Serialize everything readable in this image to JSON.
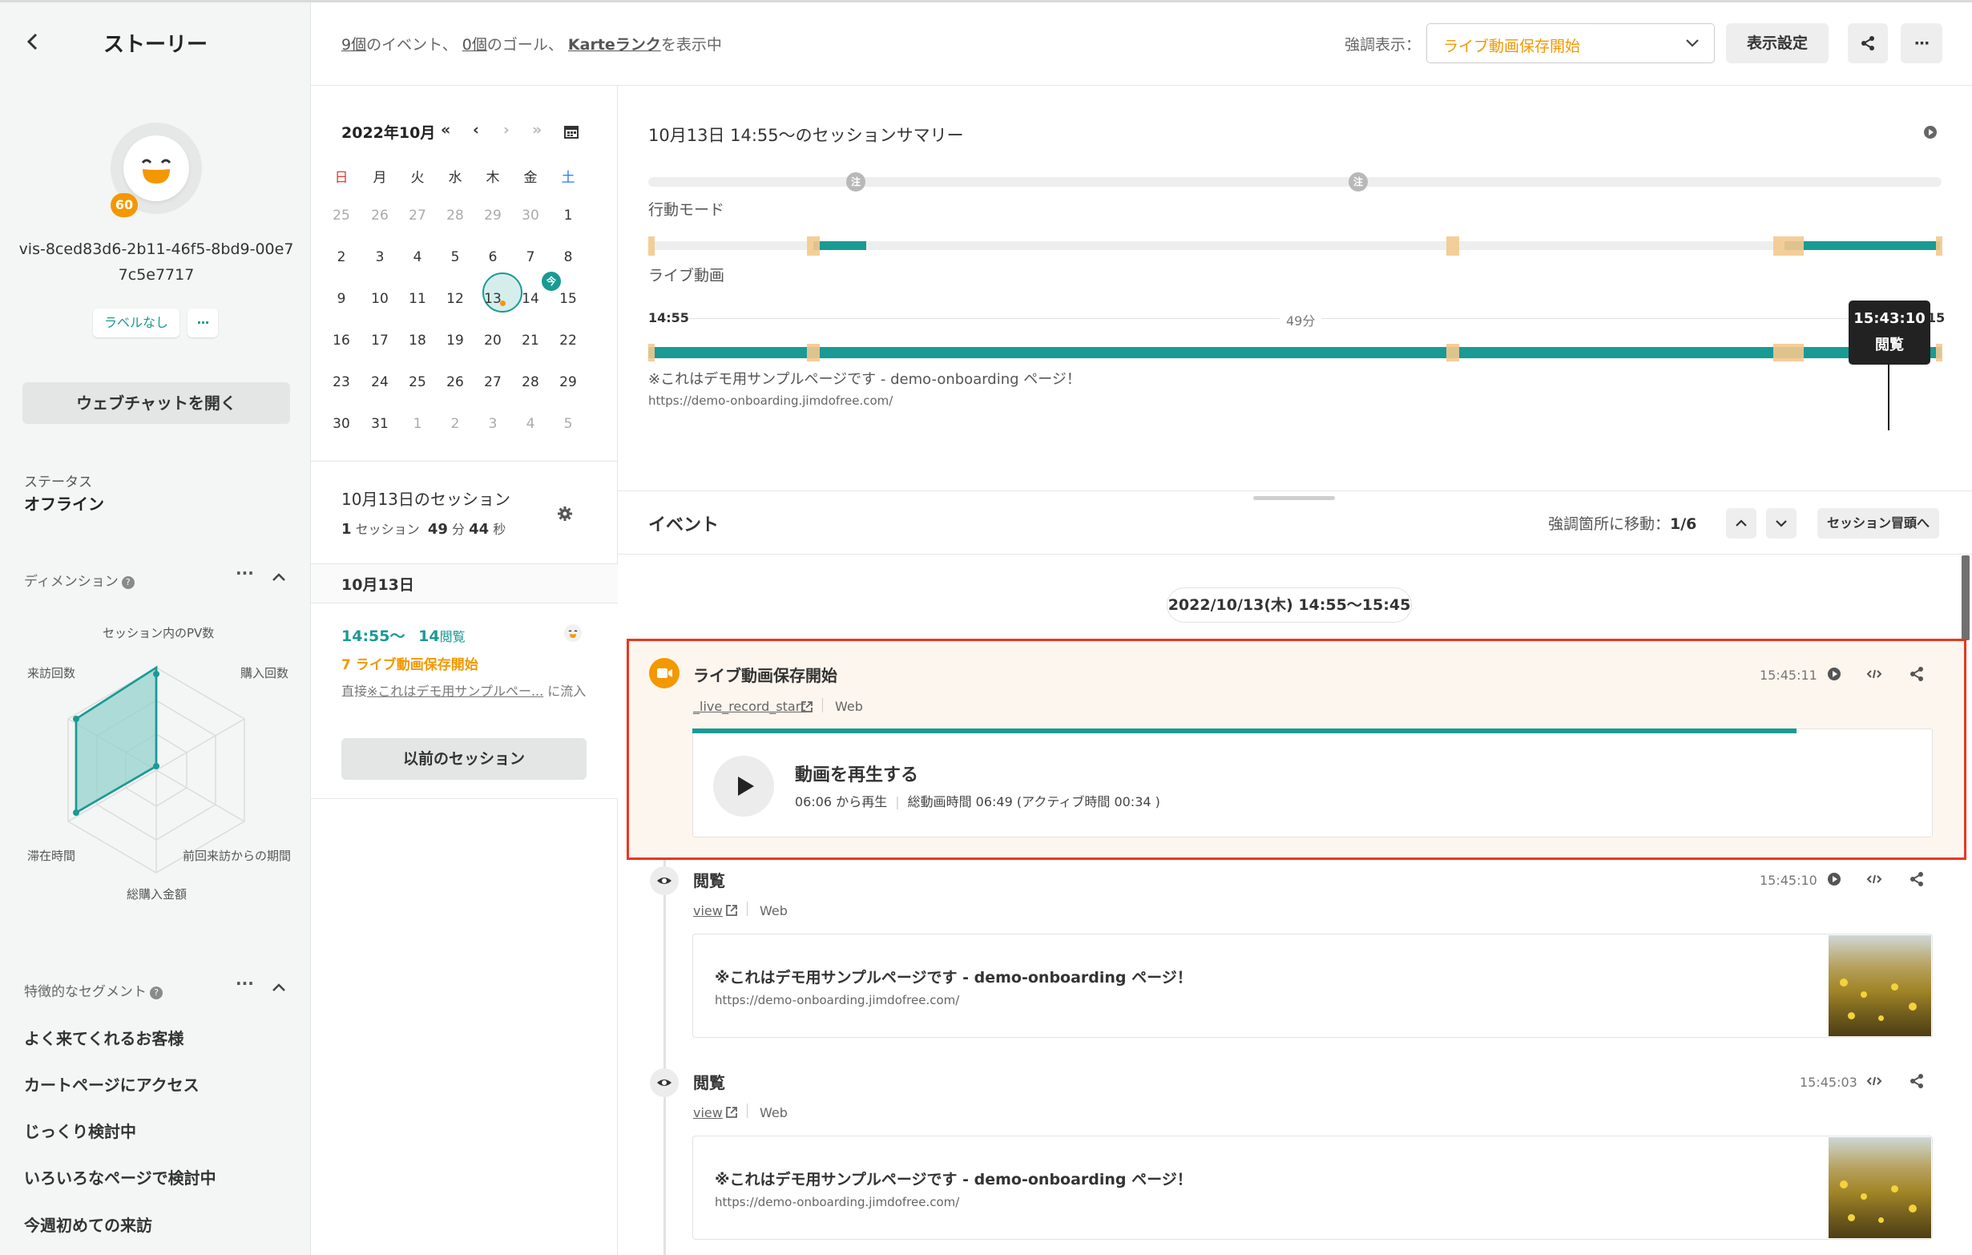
{
  "sidebar": {
    "title": "ストーリー",
    "visitor_id": "vis-8ced83d6-2b11-46f5-8bd9-00e77c5e7717",
    "score": "60",
    "label_button": "ラベルなし",
    "more_button": "···",
    "webchat_button": "ウェブチャットを開く",
    "status_label": "ステータス",
    "status_value": "オフライン",
    "dimension_title": "ディメンション",
    "radar_labels": {
      "top": "セッション内のPV数",
      "top_right": "購入回数",
      "bottom_right": "前回来訪からの期間",
      "bottom": "総購入金額",
      "bottom_left": "滞在時間",
      "top_left": "来訪回数"
    },
    "segment_title": "特徴的なセグメント",
    "segments": [
      "よく来てくれるお客様",
      "カートページにアクセス",
      "じっくり検討中",
      "いろいろなページで検討中",
      "今週初めての来訪"
    ]
  },
  "topbar": {
    "events_count": "9個",
    "events_suffix": "のイベント、",
    "goals_count": "0個",
    "goals_suffix": "のゴール、",
    "karte_rank": "Karteランク",
    "rank_suffix": "を表示中",
    "highlight_label": "強調表示：",
    "highlight_value": "ライブ動画保存開始",
    "display_settings": "表示設定"
  },
  "calendar": {
    "month": "2022年10月",
    "weekdays": [
      "日",
      "月",
      "火",
      "水",
      "木",
      "金",
      "土"
    ],
    "weeks": [
      [
        "25",
        "26",
        "27",
        "28",
        "29",
        "30",
        "1"
      ],
      [
        "2",
        "3",
        "4",
        "5",
        "6",
        "7",
        "8"
      ],
      [
        "9",
        "10",
        "11",
        "12",
        "13",
        "14",
        "15"
      ],
      [
        "16",
        "17",
        "18",
        "19",
        "20",
        "21",
        "22"
      ],
      [
        "23",
        "24",
        "25",
        "26",
        "27",
        "28",
        "29"
      ],
      [
        "30",
        "31",
        "1",
        "2",
        "3",
        "4",
        "5"
      ]
    ],
    "today_badge": "今",
    "session_day_title": "10月13日のセッション",
    "session_count": "1",
    "session_unit": "セッション",
    "duration_min": "49",
    "min_unit": "分",
    "duration_sec": "44",
    "sec_unit": "秒",
    "day_header": "10月13日",
    "session_time": "14:55〜",
    "session_views": "14",
    "views_unit": "閲覧",
    "session_live": "7 ライブ動画保存開始",
    "session_flow_prefix": "直接",
    "session_flow_link": "※これはデモ用サンプルペー...",
    "session_flow_suffix": "に流入",
    "prev_sessions": "以前のセッション"
  },
  "summary": {
    "title": "10月13日 14:55〜のセッションサマリー",
    "note_badge": "注",
    "action_mode": "行動モード",
    "live_video": "ライブ動画",
    "start_time": "14:55",
    "duration": "49分",
    "end_time": "15",
    "tooltip_time": "15:43:10",
    "tooltip_label": "閲覧",
    "page_title": "※これはデモ用サンプルページです - demo-onboarding ページ！",
    "page_url": "https://demo-onboarding.jimdofree.com/"
  },
  "events": {
    "title": "イベント",
    "move_label": "強調箇所に移動：",
    "position": "1/6",
    "session_start": "セッション冒頭へ",
    "date_range": "2022/10/13(木) 14:55〜15:45",
    "items": [
      {
        "title": "ライブ動画保存開始",
        "time": "15:45:11",
        "event_name": "_live_record_start",
        "source": "Web",
        "play_title": "動画を再生する",
        "play_from": "06:06 から再生",
        "play_meta": "総動画時間 06:49 (アクティブ時間 00:34 )",
        "progress": 0.89
      },
      {
        "title": "閲覧",
        "time": "15:45:10",
        "event_name": "view",
        "source": "Web",
        "page_title": "※これはデモ用サンプルページです - demo-onboarding ページ！",
        "page_url": "https://demo-onboarding.jimdofree.com/"
      },
      {
        "title": "閲覧",
        "time": "15:45:03",
        "event_name": "view",
        "source": "Web",
        "page_title": "※これはデモ用サンプルページです - demo-onboarding ページ！",
        "page_url": "https://demo-onboarding.jimdofree.com/"
      }
    ]
  },
  "colors": {
    "teal": "#1a9a94",
    "orange": "#f39800",
    "highlight_border": "#e8381e",
    "highlight_bg": "#fdf6ee"
  }
}
